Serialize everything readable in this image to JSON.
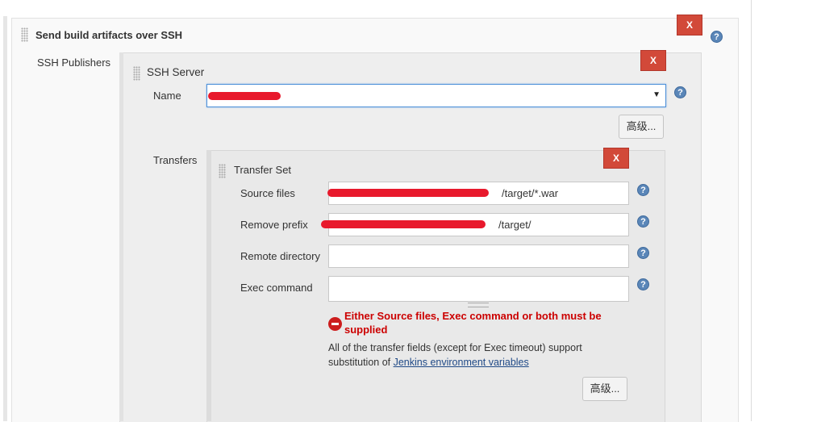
{
  "section": {
    "title": "Send build artifacts over SSH",
    "publishers_label": "SSH Publishers",
    "delete_label": "X"
  },
  "ssh_server": {
    "title": "SSH Server",
    "name_label": "Name",
    "name_value": "",
    "delete_label": "X",
    "advanced_label": "高级...",
    "transfers_label": "Transfers"
  },
  "transfer_set": {
    "title": "Transfer Set",
    "delete_label": "X",
    "source_files_label": "Source files",
    "source_files_value": "/target/*.war",
    "remove_prefix_label": "Remove prefix",
    "remove_prefix_value": "/target/",
    "remote_directory_label": "Remote directory",
    "remote_directory_value": "",
    "exec_command_label": "Exec command",
    "exec_command_value": "",
    "error_line1": "Either Source files, Exec command or both must be",
    "error_line2": "supplied",
    "info_line1": "All of the transfer fields (except for Exec timeout) support",
    "info_line2_prefix": "substitution of ",
    "info_link": "Jenkins environment variables",
    "advanced_label": "高级..."
  },
  "help_label": "?",
  "colors": {
    "delete_button": "#d24939",
    "error_text": "#cc0000",
    "help_icon": "#5a86b8",
    "link": "#204a87",
    "focus_border": "#4d90d8"
  },
  "icons": {
    "delete": "close-icon",
    "help": "help-icon",
    "error": "error-icon",
    "drag": "drag-handle-icon",
    "dropdown": "dropdown-arrow-icon"
  }
}
